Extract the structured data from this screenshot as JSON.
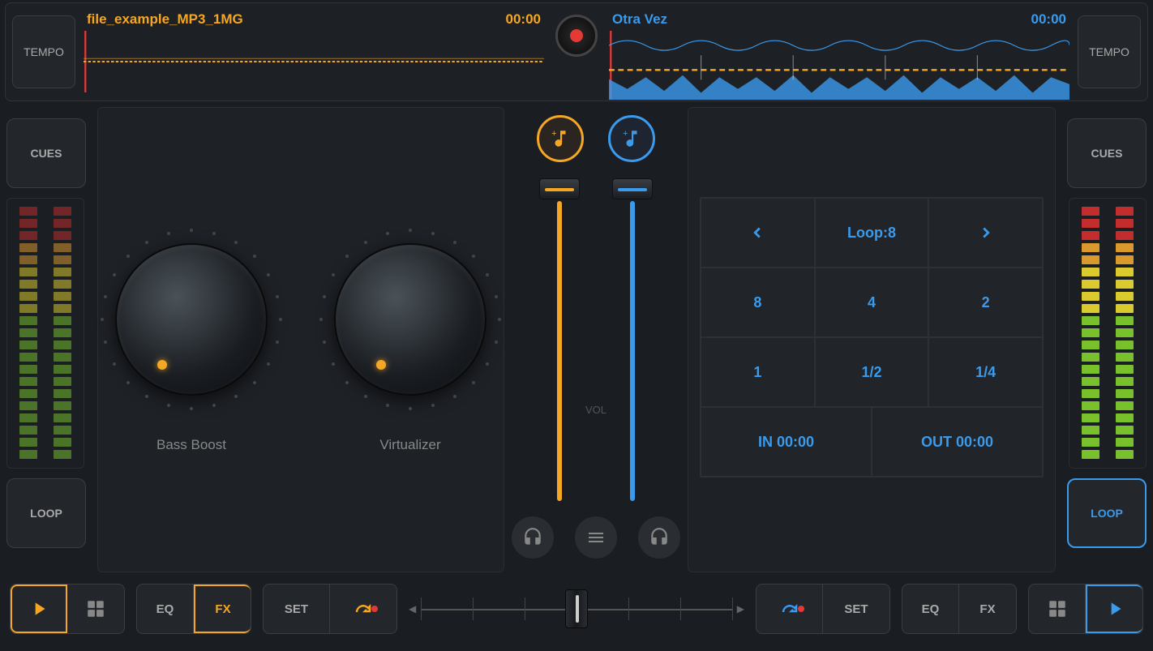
{
  "top": {
    "tempoLeft": "TEMPO",
    "tempoRight": "TEMPO",
    "trackLeft": {
      "title": "file_example_MP3_1MG",
      "time": "00:00"
    },
    "trackRight": {
      "title": "Otra Vez",
      "time": "00:00"
    }
  },
  "side": {
    "cues": "CUES",
    "loop": "LOOP"
  },
  "knobs": {
    "bass": "Bass Boost",
    "virt": "Virtualizer"
  },
  "mixer": {
    "vol": "VOL"
  },
  "loopGrid": {
    "header": "Loop:8",
    "cells": [
      "8",
      "4",
      "2",
      "1",
      "1/2",
      "1/4"
    ],
    "in": "IN 00:00",
    "out": "OUT 00:00"
  },
  "bottom": {
    "eq": "EQ",
    "fx": "FX",
    "set": "SET"
  },
  "colors": {
    "orange": "#f5a623",
    "blue": "#3a9bed",
    "red": "#e53935"
  }
}
